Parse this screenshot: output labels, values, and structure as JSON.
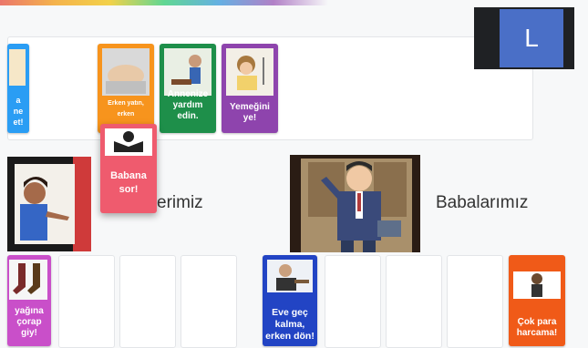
{
  "user": {
    "initial": "L"
  },
  "categories": {
    "mothers_partial": "erimiz",
    "fathers": "Babalarımız"
  },
  "cards": {
    "blue_left": {
      "text": "a\nne\net!",
      "color": "#2a9df4"
    },
    "sleep": {
      "text": "Erken yatın, erken",
      "color": "#f7941d"
    },
    "help_mom": {
      "text": "Annenize yardım edin.",
      "color": "#1e8f4a"
    },
    "eat": {
      "text": "Yemeğini ye!",
      "color": "#8e44ad"
    },
    "ask_dad": {
      "text": "Babana sor!",
      "color": "#ef5b6e"
    },
    "socks": {
      "text": "yağına çorap giy!",
      "color": "#c94fc9"
    },
    "home_early": {
      "text": "Eve geç kalma, erken dön!",
      "color": "#2244c4"
    },
    "spend": {
      "text": "Çok para harcama!",
      "color": "#f05a18"
    }
  }
}
